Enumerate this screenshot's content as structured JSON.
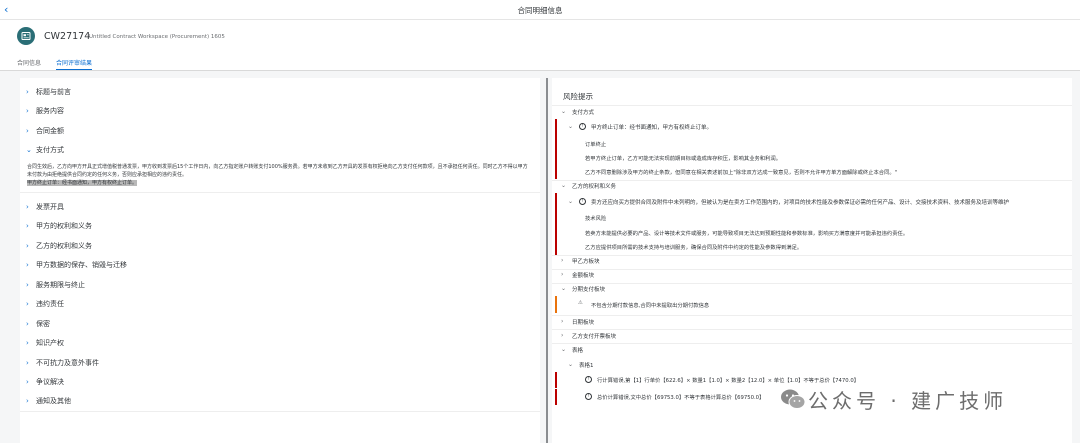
{
  "page": {
    "title": "合同明细信息",
    "back_icon": "chevron-left-icon"
  },
  "object": {
    "id": "CW27174",
    "subtitle": "Untitled Contract Workspace (Procurement) 1605",
    "avatar_icon": "contract-document-icon",
    "avatar_color": "#2a6e76"
  },
  "tabs": [
    {
      "label": "合同信息"
    },
    {
      "label": "合同评审结果"
    }
  ],
  "left": {
    "sections": [
      {
        "label": "标题与前言"
      },
      {
        "label": "服务内容"
      },
      {
        "label": "合同金额"
      },
      {
        "label": "支付方式"
      },
      {
        "label": "发票开具"
      },
      {
        "label": "甲方的权利和义务"
      },
      {
        "label": "乙方的权利和义务"
      },
      {
        "label": "甲方数据的保存、销毁与迁移"
      },
      {
        "label": "服务期限与终止"
      },
      {
        "label": "违约责任"
      },
      {
        "label": "保密"
      },
      {
        "label": "知识产权"
      },
      {
        "label": "不可抗力及意外事件"
      },
      {
        "label": "争议解决"
      },
      {
        "label": "通知及其他"
      }
    ],
    "payment_text": "合同生效后，乙方向甲方开具正式增值税普通发票，甲方收到发票后15个工作日内，向乙方指定账户转账支付100%服务费。若甲方未收到乙方开具的发票有权拒绝向乙方支付任何款项，且不承担任何责任。同时乙方不得以甲方未付款为由拒绝提供合同约定的任何义务，否则应承担相应的违约责任。",
    "payment_highlight": "甲方终止订单：经书面通知，甲方有权终止订单。"
  },
  "right": {
    "title": "风险提示",
    "groups": {
      "payment": {
        "label": "支付方式",
        "risk_title": "甲方终止订单：经书面通知，甲方有权终止订单。",
        "risk_label": "订单终止",
        "lines": [
          "若甲方终止订单，乙方可能无法实现前期目标或造成库存积压，影响其业务和利润。",
          "乙方不同意删除涉及甲方的终止条款，但同意在相关表述前加上\"除非双方达成一致意见，否则不允许甲方单方面解除或终止本合同。\""
        ]
      },
      "partyb": {
        "label": "乙方的权利和义务",
        "risk_title": "卖方还应向买方提供合同及附件中未列明的，但被认为是在卖方工作范围内的，对项目的技术性能及参数保证必需的任何产品、设计、交接技术资料、技术服务及培训等维护",
        "risk_label": "技术风险",
        "lines": [
          "若卖方未能提供必要的产品、设计等技术文件或服务，可能导致项目无法达到预期性能和参数标准，影响买方满意度并可能承担违约责任。",
          "乙方应提供项目所需的技术支持与培训服务，确保合同及附件中约定的性能及参数得到满足。"
        ]
      },
      "collapsed1": [
        {
          "label": "甲乙方板块"
        },
        {
          "label": "金额板块"
        }
      ],
      "installment": {
        "label": "分期支付板块",
        "warning": "不包含分期付款信息,合同中未提取出分期付款信息"
      },
      "collapsed2": [
        {
          "label": "日期板块"
        },
        {
          "label": "乙方支付开票板块"
        }
      ],
      "table": {
        "label": "表格",
        "sub_label": "表格1",
        "row1": "行计算错误,第【1】行单价【622.6】× 数量1【1.0】× 数量2【12.0】× 单位【1.0】不等于总价【7470.0】",
        "row2": "总价计算错误,文中总价【69753.0】不等于表格计算总价【69750.0】"
      }
    },
    "status_colors": {
      "error": "#bb0000",
      "warning": "#e9730c",
      "accent": "#0a6ed1"
    }
  },
  "watermark": {
    "text": "公众号 · 建广技师",
    "icon": "wechat-icon"
  }
}
